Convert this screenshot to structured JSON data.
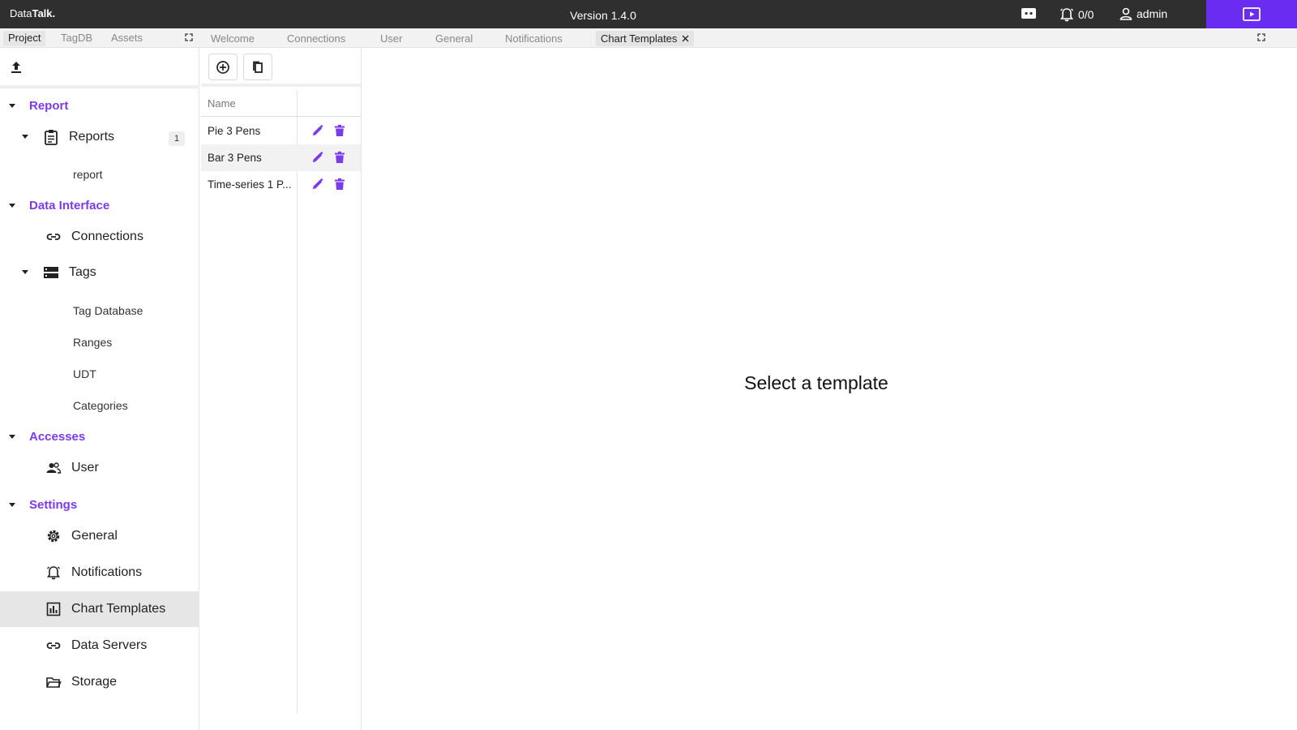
{
  "topbar": {
    "logo_prefix": "Data",
    "logo_bold": "Talk.",
    "version": "Version 1.4.0",
    "alarm_count": "0/0",
    "user": "admin"
  },
  "panel_tabs": [
    "Project",
    "TagDB",
    "Assets"
  ],
  "doc_tabs": [
    "Welcome",
    "Connections",
    "User",
    "General",
    "Notifications",
    "Chart Templates"
  ],
  "sidebar": {
    "report": {
      "label": "Report",
      "reports": {
        "label": "Reports",
        "badge": "1",
        "children": [
          "report"
        ]
      }
    },
    "data_interface": {
      "label": "Data Interface",
      "connections": "Connections",
      "tags": {
        "label": "Tags",
        "children": [
          "Tag Database",
          "Ranges",
          "UDT",
          "Categories"
        ]
      }
    },
    "accesses": {
      "label": "Accesses",
      "user": "User"
    },
    "settings": {
      "label": "Settings",
      "items": [
        "General",
        "Notifications",
        "Chart Templates",
        "Data Servers",
        "Storage"
      ]
    }
  },
  "template_list": {
    "header": "Name",
    "rows": [
      "Pie 3 Pens",
      "Bar 3 Pens",
      "Time-series 1 P..."
    ]
  },
  "content": {
    "empty_message": "Select a template"
  },
  "colors": {
    "accent": "#7c3aed",
    "topbar": "#2f2f2f",
    "present_button": "#6a2cf0"
  }
}
